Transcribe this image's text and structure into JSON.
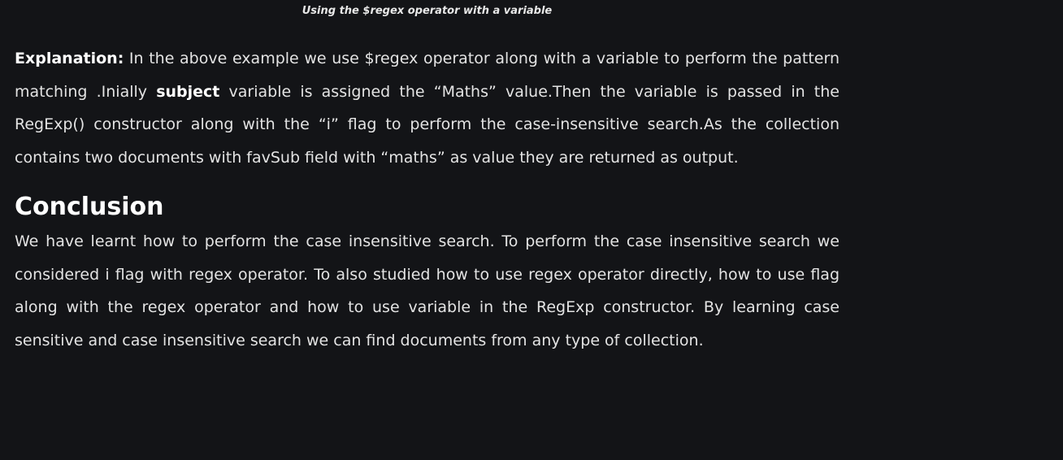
{
  "caption": "Using the $regex operator with a variable",
  "explanation": {
    "label": "Explanation:",
    "text_before": " In the above example we use $regex operator along with a variable to perform the pattern matching .Inially ",
    "bold_word": "subject",
    "text_after": " variable is assigned the “Maths” value.Then the variable is passed in the RegExp() constructor along with the “i” flag to perform the case-insensitive search.As the collection contains two documents with favSub field with “maths” as value they are returned as output."
  },
  "conclusion": {
    "heading": "Conclusion",
    "text": "We have learnt how to perform the case insensitive search. To perform the case insensitive search we considered i flag with regex operator. To also studied how to use regex operator directly, how to use flag along with the regex operator and how to use variable in the RegExp constructor. By learning case sensitive and case insensitive search we can find documents from any type of collection."
  },
  "colors": {
    "background": "#131417",
    "text": "#e3e3e3",
    "heading": "#ffffff"
  }
}
